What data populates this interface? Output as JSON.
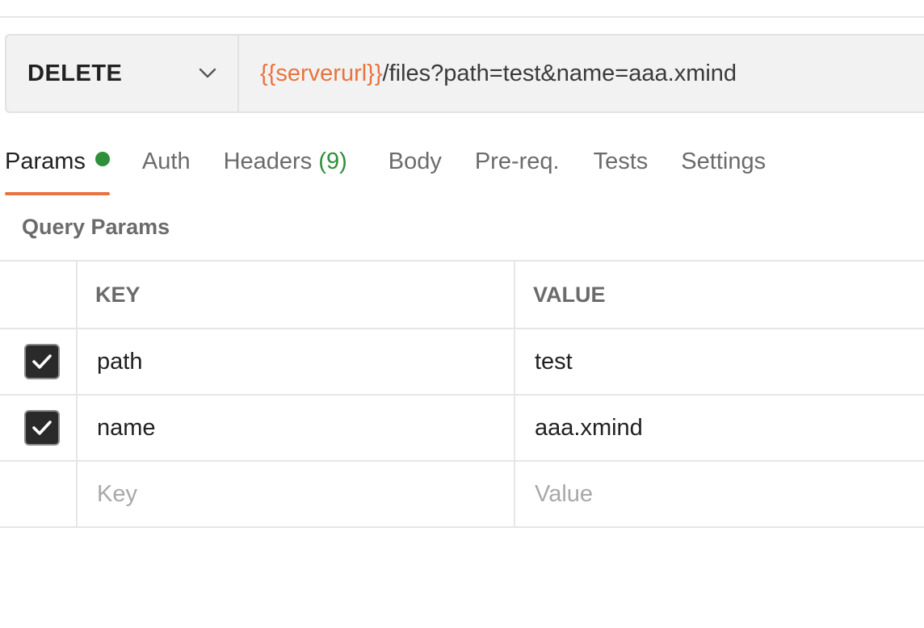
{
  "request": {
    "method": "DELETE",
    "url_variable": "{{serverurl}}",
    "url_path": "/files?path=test&name=aaa.xmind"
  },
  "tabs": [
    {
      "label": "Params",
      "active": true,
      "indicator": "green-dot"
    },
    {
      "label": "Auth"
    },
    {
      "label": "Headers",
      "count": "(9)"
    },
    {
      "label": "Body"
    },
    {
      "label": "Pre-req."
    },
    {
      "label": "Tests"
    },
    {
      "label": "Settings"
    }
  ],
  "query_params": {
    "title": "Query Params",
    "columns": {
      "key": "KEY",
      "value": "VALUE"
    },
    "rows": [
      {
        "checked": true,
        "key": "path",
        "value": "test"
      },
      {
        "checked": true,
        "key": "name",
        "value": "aaa.xmind"
      }
    ],
    "placeholder": {
      "key": "Key",
      "value": "Value"
    }
  },
  "colors": {
    "accent": "#e8733f",
    "success": "#2f8f3a",
    "checkbox_fill": "#2a2a2a"
  },
  "icons": {
    "method_dropdown": "chevron-down-icon",
    "params_indicator": "dot-icon",
    "row_checkbox": "checkmark-icon"
  }
}
